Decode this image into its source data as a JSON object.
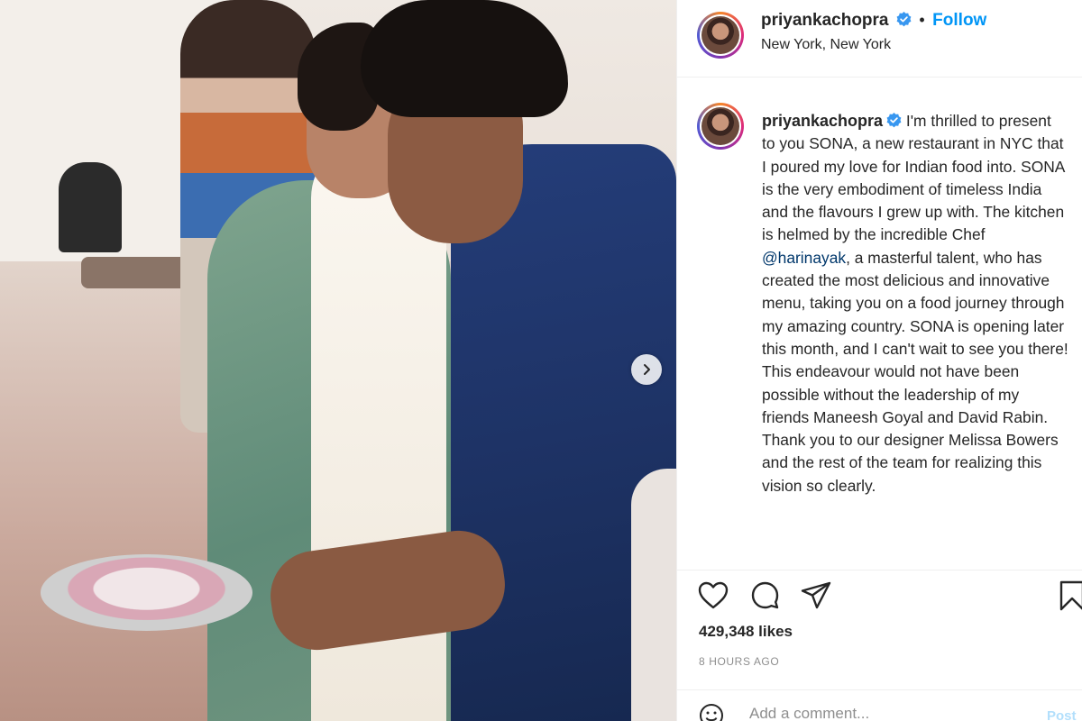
{
  "post": {
    "username": "priyankachopra",
    "follow_label": "Follow",
    "separator": "•",
    "location": "New York, New York",
    "caption_username": "priyankachopra",
    "caption_part1": "I'm thrilled to present to you SONA, a new restaurant in NYC that I poured my love for Indian food into. SONA is the very embodiment of timeless India and the flavours I grew up with. The kitchen is helmed by the incredible Chef",
    "caption_mention": "@harinayak",
    "caption_part2": ", a masterful talent, who has created the most delicious and innovative menu, taking you on a food journey through my amazing country. SONA is opening later this month, and I can't wait to see you there! This endeavour would not have been possible without the leadership of my friends Maneesh Goyal and David Rabin. Thank you to our designer Melissa Bowers and the rest of the team for realizing this vision so clearly.",
    "likes": "429,348 likes",
    "time_ago": "8 HOURS AGO",
    "comment_placeholder": "Add a comment...",
    "post_label": "Post"
  },
  "icons": {
    "like": "heart-icon",
    "comment": "comment-icon",
    "share": "paper-plane-icon",
    "save": "bookmark-icon",
    "verified": "verified-badge-icon",
    "next": "chevron-right-icon"
  },
  "colors": {
    "accent": "#0095f6",
    "verified": "#3897f0",
    "text": "#262626",
    "muted": "#8e8e8e",
    "mention": "#00376b"
  }
}
